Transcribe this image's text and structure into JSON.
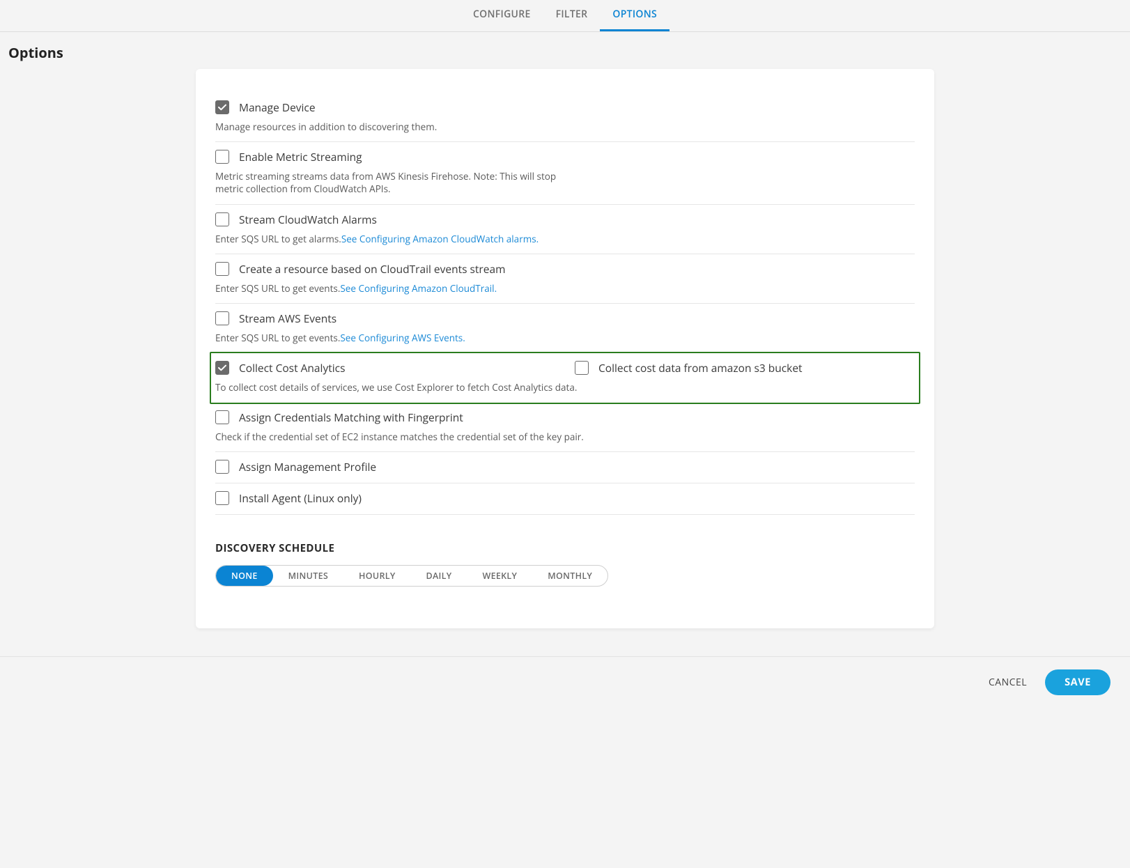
{
  "tabs": {
    "configure": "CONFIGURE",
    "filter": "FILTER",
    "options": "OPTIONS"
  },
  "page_title": "Options",
  "options": {
    "manage_device": {
      "label": "Manage Device",
      "checked": true,
      "desc": "Manage resources in addition to discovering them."
    },
    "metric_streaming": {
      "label": "Enable Metric Streaming",
      "checked": false,
      "desc": "Metric streaming streams data from AWS Kinesis Firehose. Note: This will stop metric collection from CloudWatch APIs."
    },
    "cloudwatch_alarms": {
      "label": "Stream CloudWatch Alarms",
      "checked": false,
      "desc_prefix": "Enter SQS URL to get alarms.",
      "link": "See Configuring Amazon CloudWatch alarms."
    },
    "cloudtrail": {
      "label": "Create a resource based on CloudTrail events stream",
      "checked": false,
      "desc_prefix": "Enter SQS URL to get events.",
      "link": "See Configuring Amazon CloudTrail."
    },
    "aws_events": {
      "label": "Stream AWS Events",
      "checked": false,
      "desc_prefix": "Enter SQS URL to get events.",
      "link": "See Configuring AWS Events."
    },
    "cost_analytics": {
      "label": "Collect Cost Analytics",
      "checked": true,
      "desc": "To collect cost details of services, we use Cost Explorer to fetch Cost Analytics data.",
      "s3_label": "Collect cost data from amazon s3 bucket",
      "s3_checked": false
    },
    "fingerprint": {
      "label": "Assign Credentials Matching with Fingerprint",
      "checked": false,
      "desc": "Check if the credential set of EC2 instance matches the credential set of the key pair."
    },
    "mgmt_profile": {
      "label": "Assign Management Profile",
      "checked": false
    },
    "install_agent": {
      "label": "Install Agent (Linux only)",
      "checked": false
    }
  },
  "schedule": {
    "title": "DISCOVERY SCHEDULE",
    "items": [
      "NONE",
      "MINUTES",
      "HOURLY",
      "DAILY",
      "WEEKLY",
      "MONTHLY"
    ],
    "active": "NONE"
  },
  "footer": {
    "cancel": "CANCEL",
    "save": "SAVE"
  }
}
